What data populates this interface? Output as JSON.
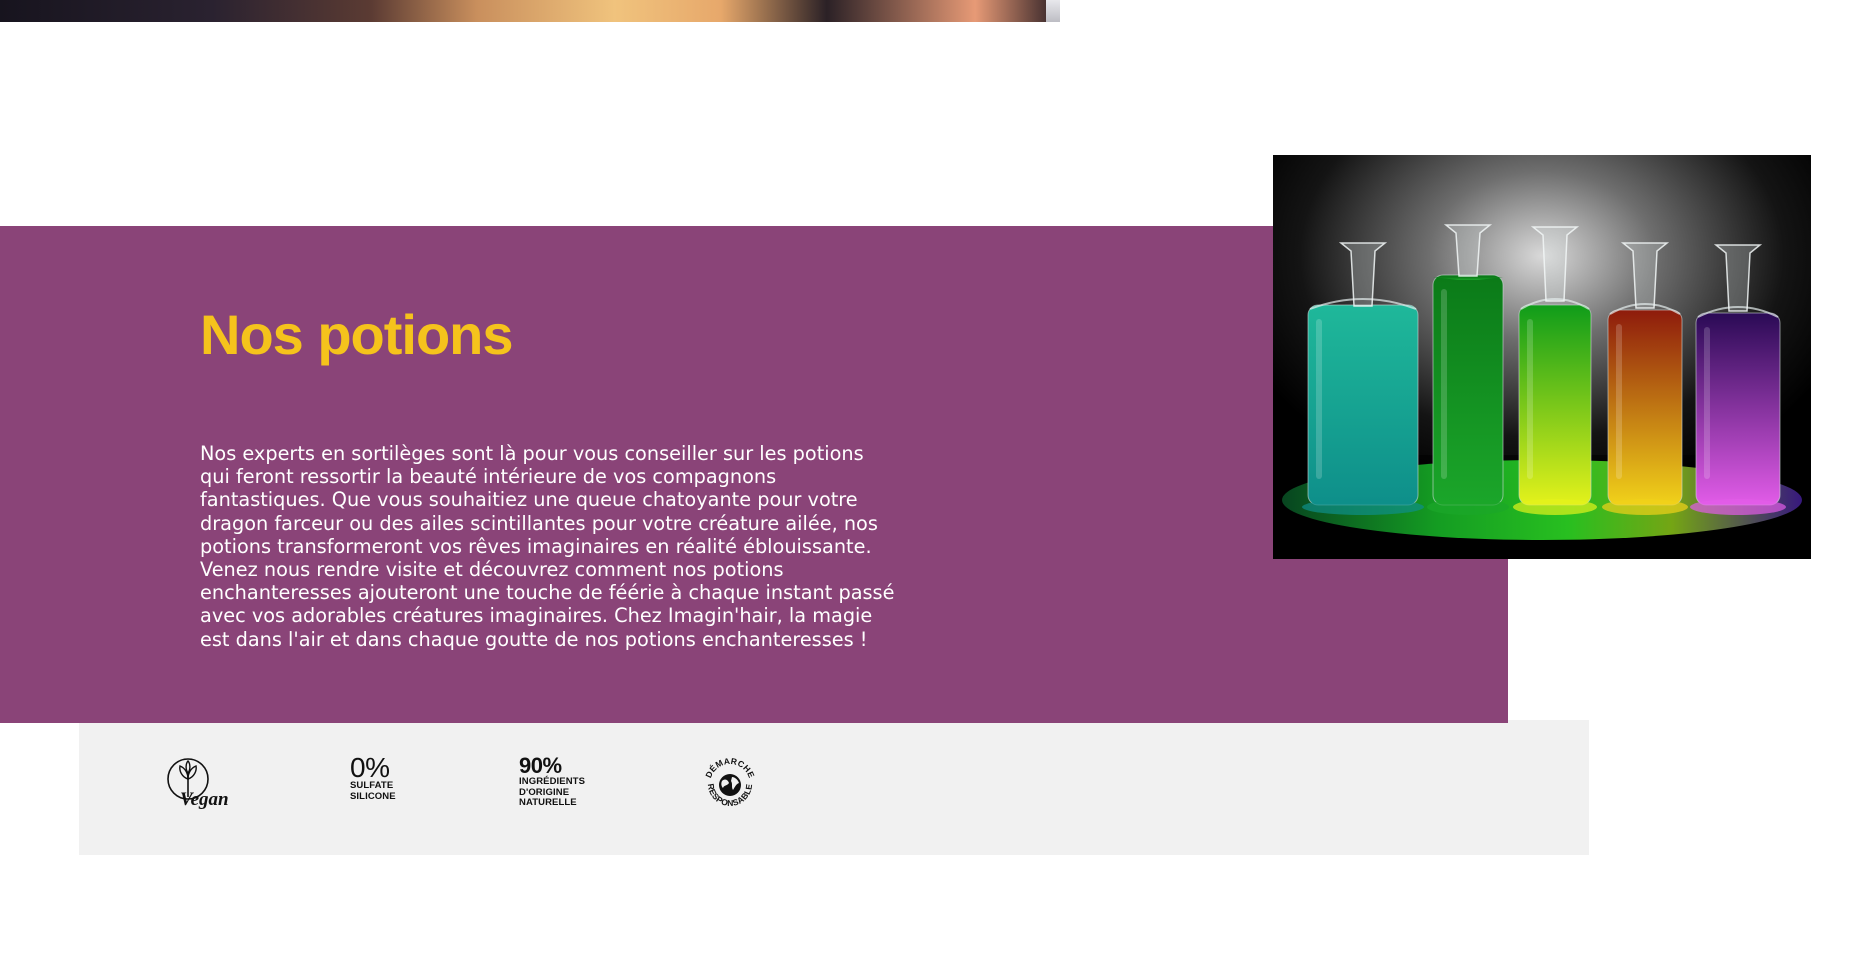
{
  "hero": {
    "title": "Nos potions",
    "paragraph_lines": [
      "Nos experts en sortilèges sont là pour vous conseiller sur les potions",
      "qui feront ressortir la beauté intérieure de vos compagnons",
      "fantastiques. Que vous souhaitiez une queue chatoyante pour votre",
      "dragon farceur ou des ailes scintillantes pour votre créature ailée, nos",
      "potions transformeront vos rêves imaginaires en réalité éblouissante.",
      "Venez nous rendre visite et découvrez comment nos potions",
      "enchanteresses ajouteront une touche de féérie à chaque instant passé",
      "avec vos adorables créatures imaginaires. Chez Imagin'hair, la magie",
      "est dans l'air et dans chaque goutte de nos potions enchanteresses !"
    ]
  },
  "potion_image": {
    "bottles": [
      {
        "name": "turquoise-potion",
        "liquid_top": "#1fb89a",
        "liquid_bottom": "#0e8f8a"
      },
      {
        "name": "green-potion",
        "liquid_top": "#0b7a18",
        "liquid_bottom": "#1ba62a"
      },
      {
        "name": "lime-potion",
        "liquid_top": "#0f9c1a",
        "liquid_bottom": "#e4f21b"
      },
      {
        "name": "orange-potion",
        "liquid_top": "#8e1b0c",
        "liquid_bottom": "#f1d21a"
      },
      {
        "name": "violet-potion",
        "liquid_top": "#2a0a55",
        "liquid_bottom": "#e25ce8"
      }
    ]
  },
  "badges": {
    "vegan": {
      "label": "Vegan",
      "icon": "vegan-flower-icon"
    },
    "sulfate": {
      "big": "0%",
      "line1": "SULFATE",
      "line2": "SILICONE"
    },
    "ingredients": {
      "big": "90%",
      "line1": "INGRÉDIENTS",
      "line2": "D'ORIGINE",
      "line3": "NATURELLE"
    },
    "demarche": {
      "top": "DÉMARCHE",
      "bottom": "RESPONSABLE",
      "icon": "globe-icon"
    }
  },
  "colors": {
    "hero_background": "#8a4478",
    "title_color": "#f5c31c",
    "badge_band": "#f1f1f1"
  }
}
